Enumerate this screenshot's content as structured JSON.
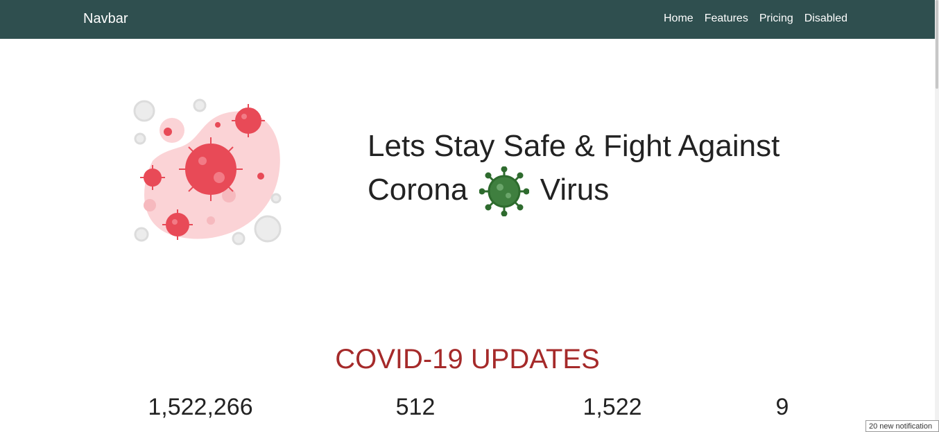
{
  "navbar": {
    "brand": "Navbar",
    "links": [
      "Home",
      "Features",
      "Pricing",
      "Disabled"
    ]
  },
  "hero": {
    "title_part1": "Lets Stay Safe & Fight Against",
    "title_part2": "Corona",
    "title_part3": "Virus",
    "illustration": "virus-illustration",
    "inline_icon": "green-virus-icon"
  },
  "updates": {
    "title": "COVID-19 UPDATES",
    "stats": [
      {
        "value": "1,522,266"
      },
      {
        "value": "512"
      },
      {
        "value": "1,522"
      },
      {
        "value": "9"
      }
    ]
  },
  "notification": {
    "text": "20 new notification"
  },
  "colors": {
    "navbar_bg": "#2f4f4f",
    "section_title": "#a52a2a",
    "virus_red": "#e84a57",
    "virus_green": "#2e6b2e"
  }
}
